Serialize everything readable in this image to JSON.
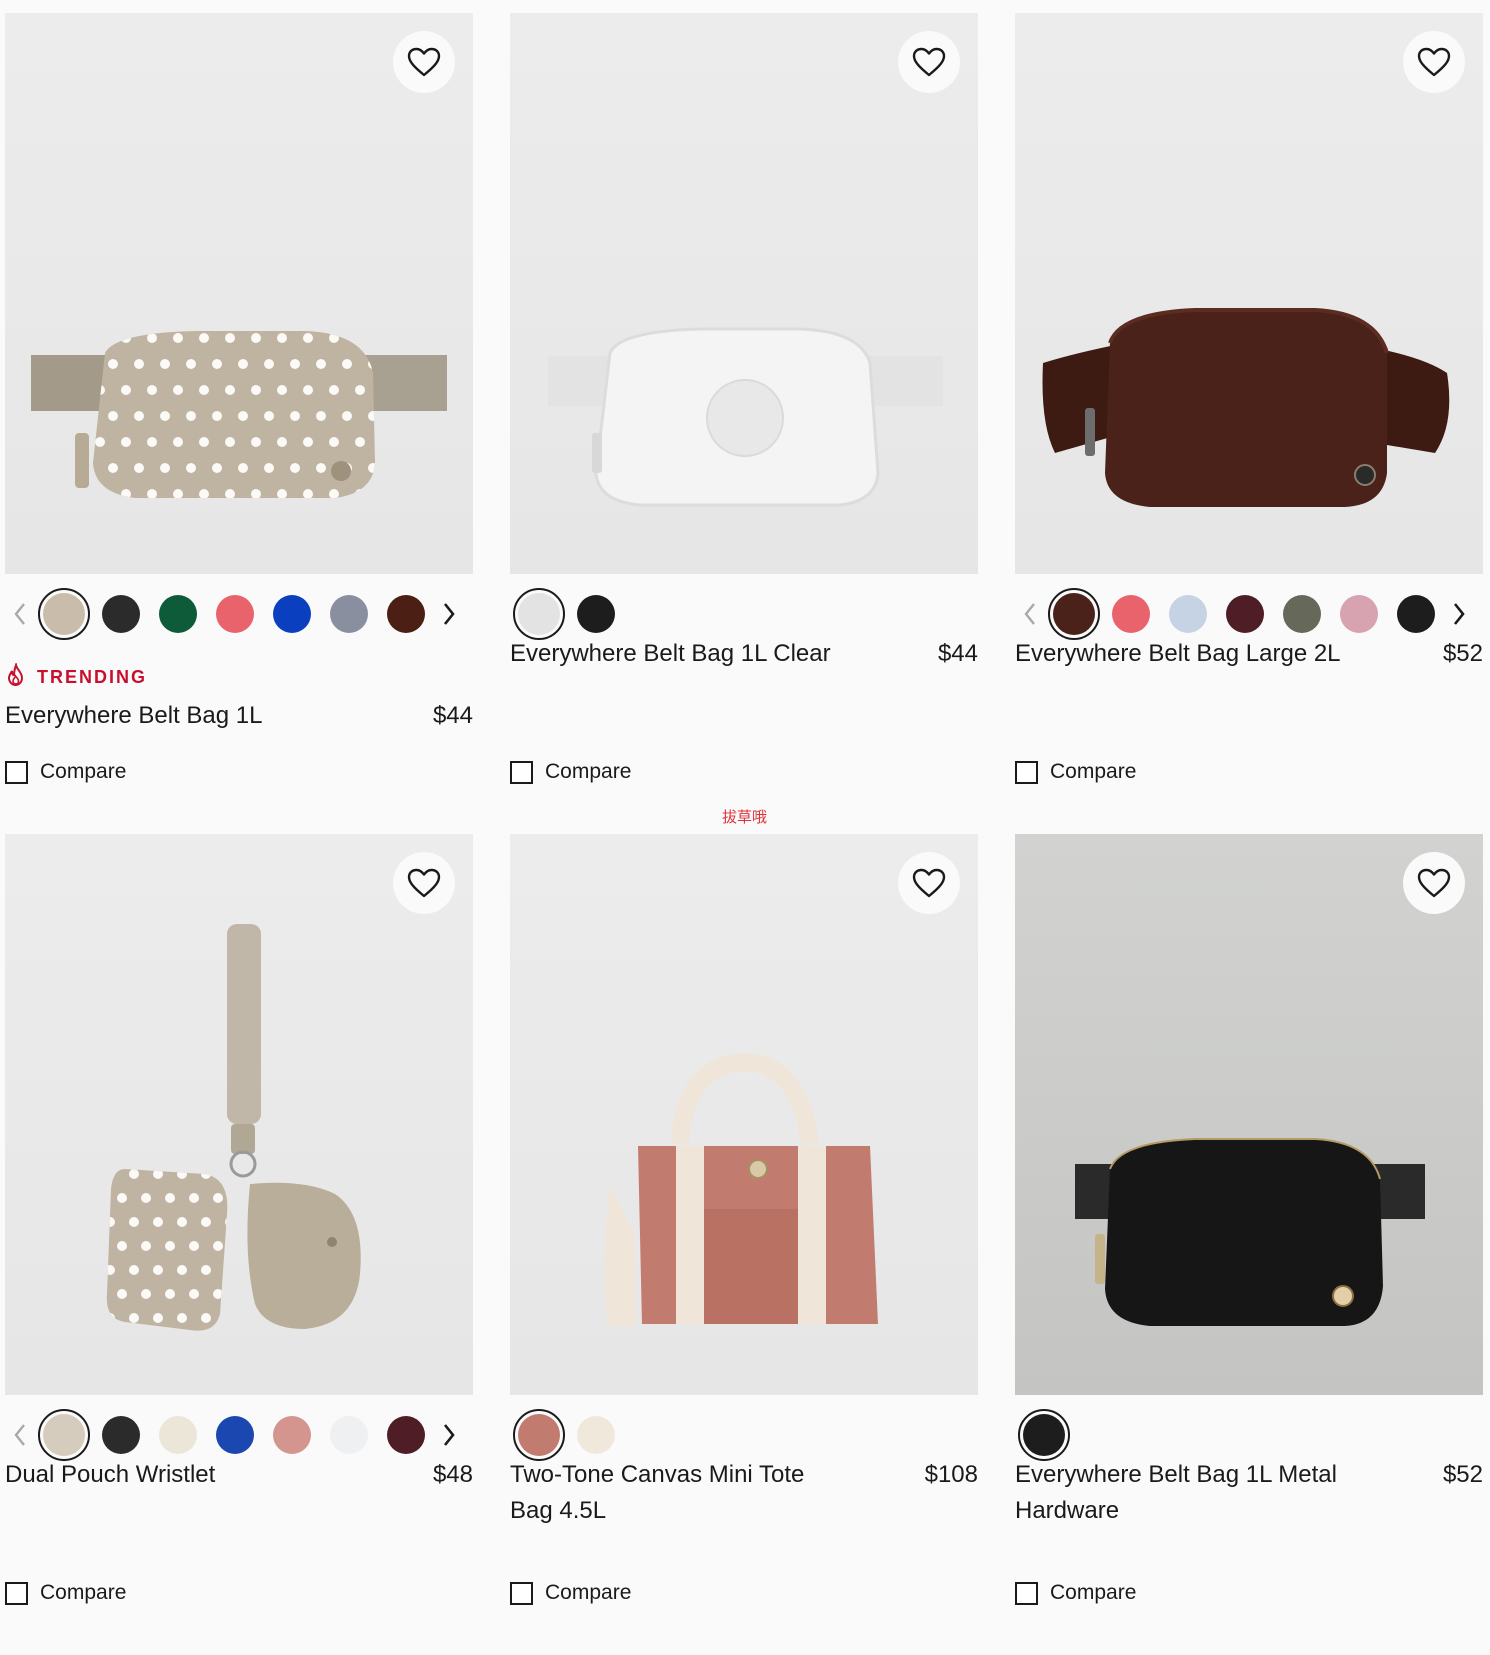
{
  "products": [
    {
      "name": "Everywhere Belt Bag 1L",
      "price": "$44",
      "badge": "TRENDING",
      "compare_label": "Compare",
      "has_prev": true,
      "has_next": true,
      "swatches": [
        "#c9bcaa",
        "#2b2b2b",
        "#0e5b3a",
        "#e8636b",
        "#0a3fbf",
        "#8a8fa0",
        "#4b1f14"
      ],
      "art": "polka-belt"
    },
    {
      "name": "Everywhere Belt Bag 1L Clear",
      "price": "$44",
      "badge": "",
      "compare_label": "Compare",
      "has_prev": false,
      "has_next": false,
      "swatches": [
        "#e3e3e3",
        "#1d1d1d"
      ],
      "art": "clear-belt"
    },
    {
      "name": "Everywhere Belt Bag Large 2L",
      "price": "$52",
      "badge": "",
      "compare_label": "Compare",
      "has_prev": true,
      "has_next": true,
      "swatches": [
        "#4a2219",
        "#e8636b",
        "#c6d3e4",
        "#4e1d26",
        "#66695a",
        "#d7a3b0",
        "#1d1d1d"
      ],
      "art": "brown-belt"
    },
    {
      "name": "Dual Pouch Wristlet",
      "price": "$48",
      "badge": "",
      "compare_label": "Compare",
      "has_prev": true,
      "has_next": true,
      "swatches": [
        "#d6ccbd",
        "#2b2b2b",
        "#ece6d9",
        "#1a47b0",
        "#d3958e",
        "#eef0f1",
        "#4e1d26"
      ],
      "art": "wristlet"
    },
    {
      "name": "Two-Tone Canvas Mini Tote Bag 4.5L",
      "price": "$108",
      "badge": "",
      "compare_label": "Compare",
      "has_prev": false,
      "has_next": false,
      "swatches": [
        "#c27c6f",
        "#f1e8dc"
      ],
      "art": "tote"
    },
    {
      "name": "Everywhere Belt Bag 1L Metal Hardware",
      "price": "$52",
      "badge": "",
      "compare_label": "Compare",
      "has_prev": false,
      "has_next": false,
      "swatches": [
        "#1d1d1d"
      ],
      "art": "black-belt"
    }
  ],
  "watermark": "拔草哦",
  "icons": {
    "wishlist": "heart-outline-icon",
    "prev": "chevron-left-icon",
    "next": "chevron-right-icon",
    "trending": "flame-icon"
  },
  "colors": {
    "trending": "#c8102e",
    "text": "#1a1a1a"
  }
}
